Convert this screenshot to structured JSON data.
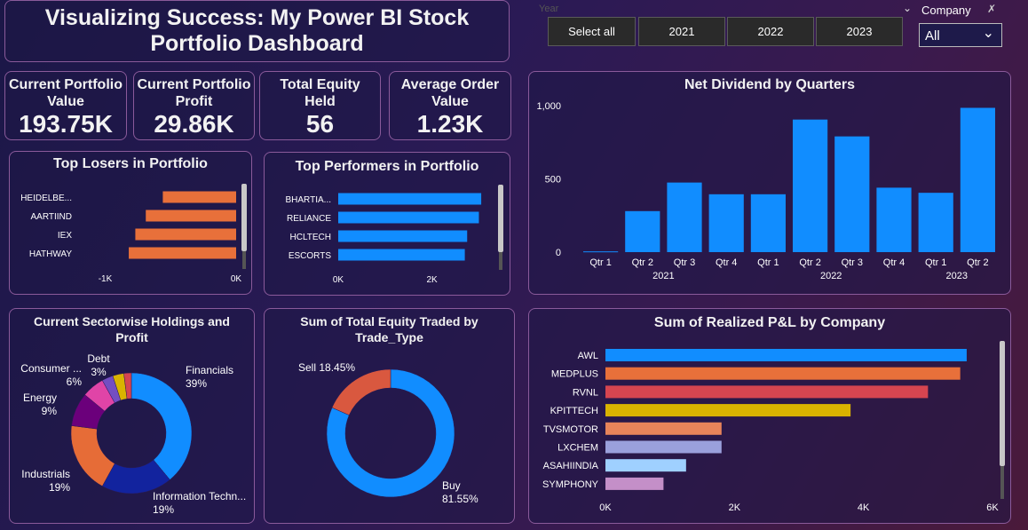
{
  "header": {
    "title": "Visualizing Success: My Power BI Stock Portfolio Dashboard"
  },
  "slicers": {
    "year": {
      "label": "Year",
      "buttons": [
        "Select all",
        "2021",
        "2022",
        "2023"
      ]
    },
    "company": {
      "label": "Company",
      "value": "All"
    }
  },
  "kpis": [
    {
      "label": "Current Portfolio Value",
      "value": "193.75K"
    },
    {
      "label": "Current Portfolio Profit",
      "value": "29.86K"
    },
    {
      "label": "Total Equity Held",
      "value": "56"
    },
    {
      "label": "Average Order Value",
      "value": "1.23K"
    }
  ],
  "colors": {
    "orange": "#e8703a",
    "blue": "#118dff",
    "panel_border": "#8a5a9a"
  },
  "chart_data": [
    {
      "id": "losers",
      "type": "bar",
      "orientation": "horizontal",
      "title": "Top Losers in Portfolio",
      "categories": [
        "HEIDELBE...",
        "AARTIIND",
        "IEX",
        "HATHWAY"
      ],
      "values": [
        -560,
        -690,
        -770,
        -820
      ],
      "xlim": [
        -1200,
        0
      ],
      "xticks": [
        {
          "v": -1000,
          "label": "-1K"
        },
        {
          "v": 0,
          "label": "0K"
        }
      ],
      "color": "#e8703a"
    },
    {
      "id": "performers",
      "type": "bar",
      "orientation": "horizontal",
      "title": "Top Performers in Portfolio",
      "categories": [
        "BHARTIA...",
        "RELIANCE",
        "HCLTECH",
        "ESCORTS"
      ],
      "values": [
        3050,
        3000,
        2750,
        2700
      ],
      "xlim": [
        0,
        3200
      ],
      "xticks": [
        {
          "v": 0,
          "label": "0K"
        },
        {
          "v": 2000,
          "label": "2K"
        }
      ],
      "color": "#118dff"
    },
    {
      "id": "dividend",
      "type": "bar",
      "title": "Net Dividend by Quarters",
      "categories": [
        "Qtr 1",
        "Qtr 2",
        "Qtr 3",
        "Qtr 4",
        "Qtr 1",
        "Qtr 2",
        "Qtr 3",
        "Qtr 4",
        "Qtr 1",
        "Qtr 2"
      ],
      "groups": [
        {
          "label": "2021",
          "span": 4
        },
        {
          "label": "2022",
          "span": 4
        },
        {
          "label": "2023",
          "span": 2
        }
      ],
      "values": [
        5,
        280,
        475,
        395,
        395,
        905,
        790,
        440,
        405,
        985
      ],
      "ylim": [
        0,
        1000
      ],
      "yticks": [
        {
          "v": 0,
          "label": "0"
        },
        {
          "v": 500,
          "label": "500"
        },
        {
          "v": 1000,
          "label": "1,000"
        }
      ],
      "color": "#118dff"
    },
    {
      "id": "sectors",
      "type": "pie",
      "title": "Current Sectorwise Holdings and Profit",
      "slices": [
        {
          "name": "Financials",
          "value": 39,
          "label": "39%",
          "color": "#118dff"
        },
        {
          "name": "Information Techn...",
          "value": 19,
          "label": "19%",
          "color": "#12239e"
        },
        {
          "name": "Industrials",
          "value": 19,
          "label": "19%",
          "color": "#e66c37"
        },
        {
          "name": "Energy",
          "value": 9,
          "label": "9%",
          "color": "#6b007b"
        },
        {
          "name": "Consumer ...",
          "value": 6,
          "label": "6%",
          "color": "#e044a7"
        },
        {
          "name": "Other",
          "value": 3,
          "label": "",
          "color": "#744ec2"
        },
        {
          "name": "Debt",
          "value": 3,
          "label": "3%",
          "color": "#d9b300"
        },
        {
          "name": "Other2",
          "value": 2,
          "label": "",
          "color": "#d64550"
        }
      ]
    },
    {
      "id": "tradetype",
      "type": "pie",
      "title": "Sum of Total Equity Traded by Trade_Type",
      "slices": [
        {
          "name": "Buy",
          "value": 81.55,
          "label": "81.55%",
          "color": "#118dff"
        },
        {
          "name": "Sell",
          "value": 18.45,
          "label": "18.45%",
          "color": "#d9583f"
        }
      ]
    },
    {
      "id": "realized",
      "type": "bar",
      "orientation": "horizontal",
      "title": "Sum of Realized P&L by Company",
      "categories": [
        "AWL",
        "MEDPLUS",
        "RVNL",
        "KPITTECH",
        "TVSMOTOR",
        "LXCHEM",
        "ASAHIINDIA",
        "SYMPHONY"
      ],
      "values": [
        5600,
        5500,
        5000,
        3800,
        1800,
        1800,
        1250,
        900
      ],
      "colors": [
        "#118dff",
        "#e8703a",
        "#d64550",
        "#d9b300",
        "#e8845a",
        "#9aa0dc",
        "#9fd0ff",
        "#c48fc8"
      ],
      "xlim": [
        0,
        6000
      ],
      "xticks": [
        {
          "v": 0,
          "label": "0K"
        },
        {
          "v": 2000,
          "label": "2K"
        },
        {
          "v": 4000,
          "label": "4K"
        },
        {
          "v": 6000,
          "label": "6K"
        }
      ]
    }
  ]
}
